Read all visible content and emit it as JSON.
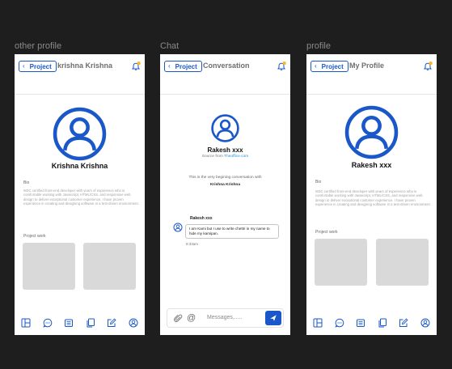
{
  "frames": [
    {
      "label": "other profile",
      "header": {
        "back_label": "Project",
        "title": "krishna Krishna"
      },
      "profile": {
        "name": "Krishna Krishna",
        "bio_label": "Bio",
        "bio_text": "W3C certified front-end developer with years of experience who is comfortable working with Javascript, HTML/CSS, and responsive web design to deliver exceptional customer experience. I have proven experience in creating and designing software in a test-driven environment.",
        "project_label": "Project work"
      }
    },
    {
      "label": "Chat",
      "header": {
        "back_label": "Project",
        "title": "Conversation"
      },
      "contact": {
        "name": "Rakesh xxx",
        "source_prefix": "Source from",
        "source_link": "Theoffice.com"
      },
      "intro_text": "This is the very begining  conversation with",
      "intro_name": "Krishna Krishna",
      "message": {
        "sender": "Rakesh xxx",
        "text": "I am Kami but I use to write chettri in my name to hide my kamipan.",
        "time": "8:33am"
      },
      "compose": {
        "placeholder": "Messages,....."
      }
    },
    {
      "label": "profile",
      "header": {
        "back_label": "Project",
        "title": "My Profile"
      },
      "profile": {
        "name": "Rakesh xxx",
        "bio_label": "Bio",
        "bio_text": "W3C certified front-end developer with years of experience who is comfortable working with Javascript, HTML/CSS, and responsive web design to deliver exceptional customer experience. I have proven experience in creating and designing software in a test-driven environment.",
        "project_label": "Project work"
      }
    }
  ],
  "icons": {
    "back": "chevron-left-icon",
    "notification": "bell-icon",
    "avatar": "user-avatar-icon",
    "nav": [
      "layout-icon",
      "chat-icon",
      "document-icon",
      "copy-icon",
      "edit-icon",
      "profile-icon"
    ],
    "attach": "paperclip-icon",
    "mention": "at-sign-icon",
    "send": "send-icon"
  },
  "colors": {
    "accent": "#1a57c9",
    "notification_dot": "#f5b82e",
    "canvas": "#1e1e1e",
    "placeholder": "#d9d9d9"
  }
}
